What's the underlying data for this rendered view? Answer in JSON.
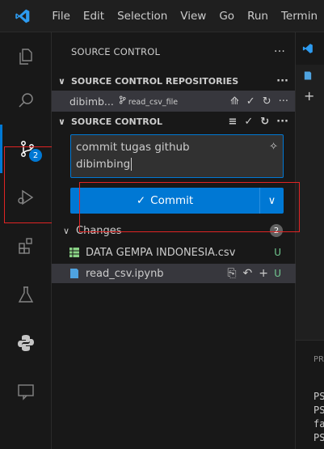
{
  "titlebar": {
    "menu": [
      "File",
      "Edit",
      "Selection",
      "View",
      "Go",
      "Run",
      "Termin"
    ]
  },
  "activity_bar": {
    "items": [
      {
        "icon": "explorer-icon"
      },
      {
        "icon": "search-icon"
      },
      {
        "icon": "source-control-icon",
        "badge": "2"
      },
      {
        "icon": "run-debug-icon"
      },
      {
        "icon": "extensions-icon"
      },
      {
        "icon": "testing-icon"
      },
      {
        "icon": "python-icon"
      },
      {
        "icon": "remote-explorer-icon"
      }
    ]
  },
  "sidebar": {
    "title": "SOURCE CONTROL",
    "repositories_header": "SOURCE CONTROL REPOSITORIES",
    "repo_name": "dibimb...",
    "repo_branch": "read_csv_file",
    "source_control_header": "SOURCE CONTROL",
    "commit_message_line1": "commit tugas github",
    "commit_message_line2": "dibimbing",
    "commit_button": "Commit",
    "changes_label": "Changes",
    "changes_count": "2",
    "files": [
      {
        "name": "DATA GEMPA INDONESIA.csv",
        "status": "U"
      },
      {
        "name": "read_csv.ipynb",
        "status": "U"
      }
    ]
  },
  "panel": {
    "tab": "PR",
    "terminal_lines": [
      "PS",
      "PS",
      "fa",
      "PS"
    ]
  },
  "colors": {
    "accent": "#0078d4",
    "untracked": "#73c991",
    "annotation": "#e02424"
  }
}
